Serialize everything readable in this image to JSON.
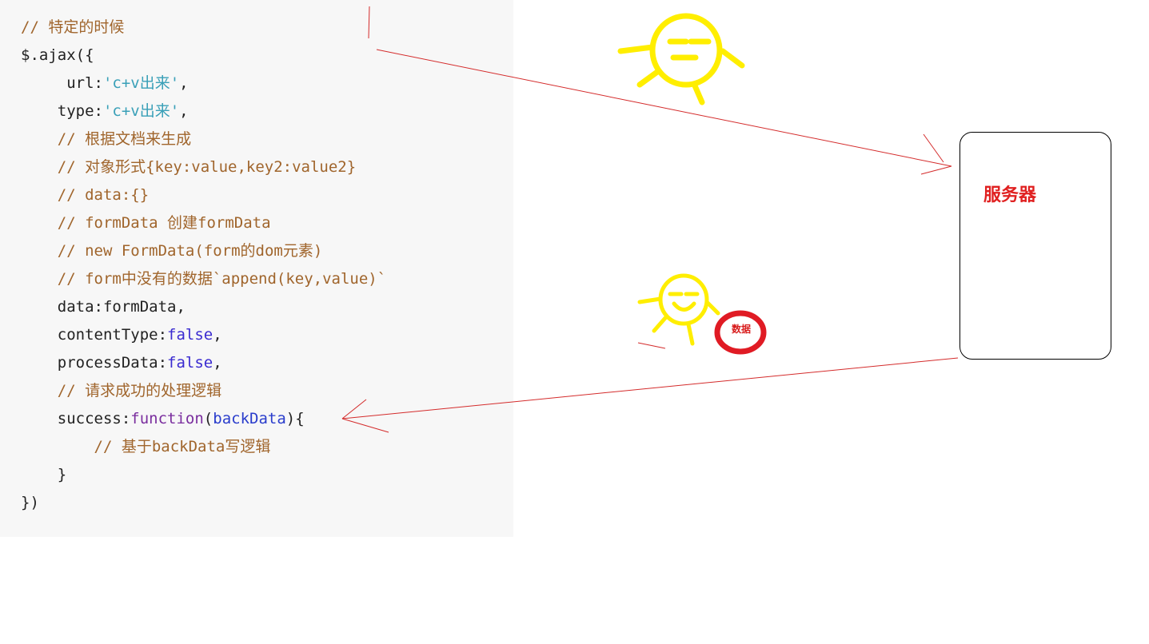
{
  "code": {
    "lines": [
      {
        "tokens": [
          {
            "t": "// 特定的时候",
            "c": "comment"
          }
        ]
      },
      {
        "tokens": [
          {
            "t": "$.ajax({",
            "c": "plain"
          }
        ]
      },
      {
        "tokens": [
          {
            "t": "     url:",
            "c": "plain"
          },
          {
            "t": "'c+v出来'",
            "c": "string"
          },
          {
            "t": ",",
            "c": "plain"
          }
        ]
      },
      {
        "tokens": [
          {
            "t": "    type:",
            "c": "plain"
          },
          {
            "t": "'c+v出来'",
            "c": "string"
          },
          {
            "t": ",",
            "c": "plain"
          }
        ]
      },
      {
        "tokens": [
          {
            "t": "    // 根据文档来生成",
            "c": "comment"
          }
        ]
      },
      {
        "tokens": [
          {
            "t": "    // 对象形式{key:value,key2:value2}",
            "c": "comment"
          }
        ]
      },
      {
        "tokens": [
          {
            "t": "    // data:{}",
            "c": "comment"
          }
        ]
      },
      {
        "tokens": [
          {
            "t": "    // formData 创建formData",
            "c": "comment"
          }
        ]
      },
      {
        "tokens": [
          {
            "t": "    // new FormData(form的dom元素)",
            "c": "comment"
          }
        ]
      },
      {
        "tokens": [
          {
            "t": "    // form中没有的数据`append(key,value)`",
            "c": "comment"
          }
        ]
      },
      {
        "tokens": [
          {
            "t": "    data:formData,",
            "c": "plain"
          }
        ]
      },
      {
        "tokens": [
          {
            "t": "    contentType:",
            "c": "plain"
          },
          {
            "t": "false",
            "c": "bool"
          },
          {
            "t": ",",
            "c": "plain"
          }
        ]
      },
      {
        "tokens": [
          {
            "t": "    processData:",
            "c": "plain"
          },
          {
            "t": "false",
            "c": "bool"
          },
          {
            "t": ",",
            "c": "plain"
          }
        ]
      },
      {
        "tokens": [
          {
            "t": "    // 请求成功的处理逻辑",
            "c": "comment"
          }
        ]
      },
      {
        "tokens": [
          {
            "t": "    success:",
            "c": "plain"
          },
          {
            "t": "function",
            "c": "keyword"
          },
          {
            "t": "(",
            "c": "plain"
          },
          {
            "t": "backData",
            "c": "param"
          },
          {
            "t": "){",
            "c": "plain"
          }
        ]
      },
      {
        "tokens": [
          {
            "t": "        // 基于backData写逻辑",
            "c": "comment"
          }
        ]
      },
      {
        "tokens": [
          {
            "t": "    }",
            "c": "plain"
          }
        ]
      },
      {
        "tokens": [
          {
            "t": "})",
            "c": "plain"
          }
        ]
      }
    ]
  },
  "diagram": {
    "server_label": "服务器",
    "data_label": "数据"
  },
  "colors": {
    "arrow": "#d42b2b",
    "face": "#ffee00",
    "data_circle": "#e01b24"
  }
}
